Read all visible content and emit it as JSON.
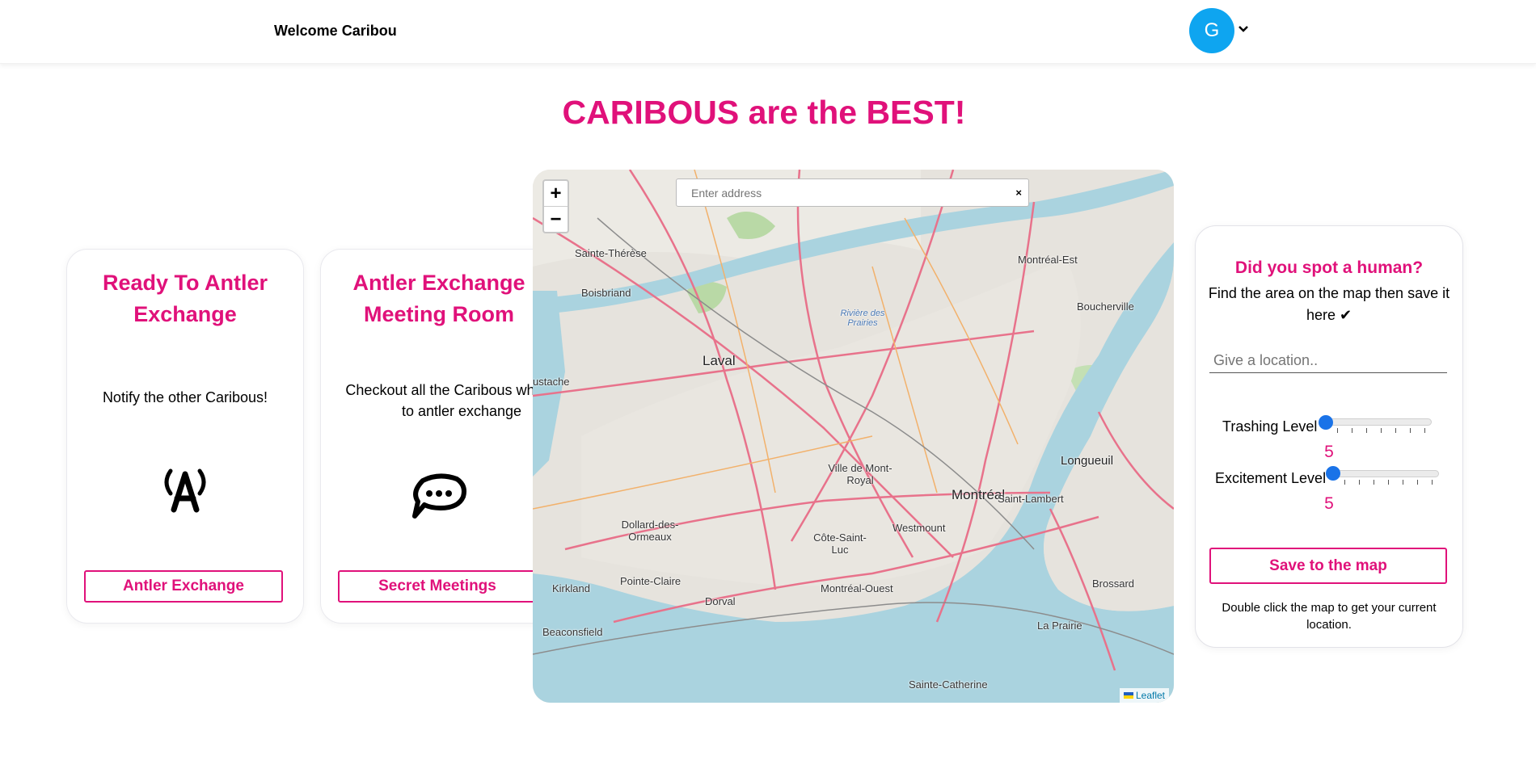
{
  "header": {
    "welcome": "Welcome Caribou",
    "avatar_letter": "G"
  },
  "headline": "CARIBOUS are the BEST!",
  "cards": [
    {
      "title": "Ready To Antler Exchange",
      "text": "Notify the other Caribous!",
      "button": "Antler Exchange",
      "icon": "radio-tower-icon"
    },
    {
      "title": "Antler Exchange Meeting Room",
      "text": "Checkout all the Caribous who want to antler exchange",
      "button": "Secret Meetings",
      "icon": "chat-bubble-icon"
    }
  ],
  "map": {
    "zoom_in": "+",
    "zoom_out": "−",
    "address_placeholder": "Enter address",
    "clear": "×",
    "attribution": "Leaflet",
    "labels": {
      "laval": "Laval",
      "montreal": "Montréal",
      "longueuil": "Longueuil",
      "sainte_therese": "Sainte-Thérèse",
      "boisbriand": "Boisbriand",
      "boucherville": "Boucherville",
      "montreal_est": "Montréal-Est",
      "ville_mont_royal": "Ville de Mont-Royal",
      "westmount": "Westmount",
      "cote_saint_luc": "Côte-Saint-Luc",
      "dollard": "Dollard-des-Ormeaux",
      "pointe_claire": "Pointe-Claire",
      "kirkland": "Kirkland",
      "dorval": "Dorval",
      "beaconsfield": "Beaconsfield",
      "montreal_ouest": "Montréal-Ouest",
      "saint_lambert": "Saint-Lambert",
      "brossard": "Brossard",
      "la_prairie": "La Prairie",
      "sainte_catherine": "Sainte-Catherine",
      "riviere_des_prairies": "Rivière des Prairies",
      "mustache": "ustache"
    }
  },
  "panel": {
    "title": "Did you spot a human?",
    "text": "Find the area on the map then save it here ✔",
    "location_placeholder": "Give a location..",
    "trashing": {
      "label": "Trashing Level",
      "value": "5"
    },
    "excitement": {
      "label": "Excitement Level",
      "value": "5"
    },
    "save_button": "Save to the map",
    "hint": "Double click the map to get your current location."
  },
  "colors": {
    "accent": "#e0117a",
    "avatar": "#0ea5f0",
    "slider": "#1a73e8"
  }
}
